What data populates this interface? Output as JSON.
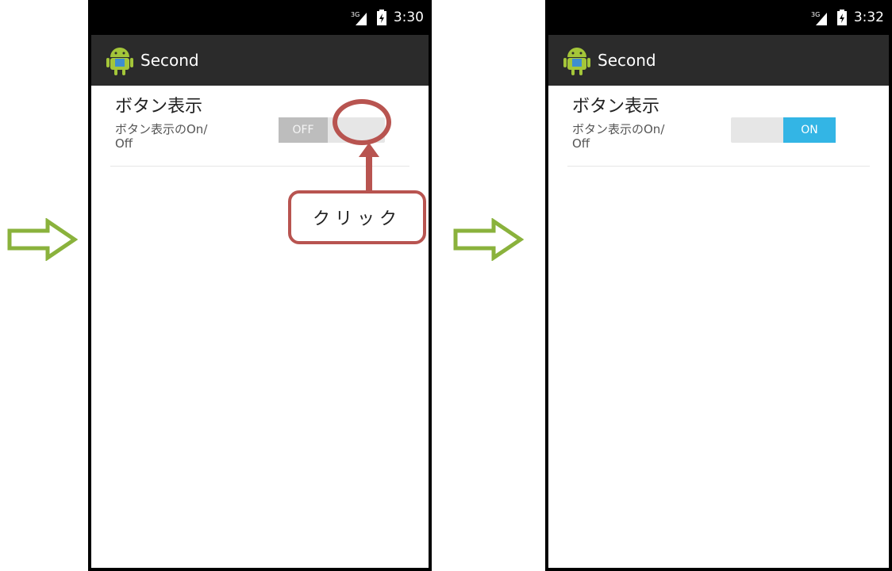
{
  "screens": [
    {
      "status_bar": {
        "network": "3G",
        "time": "3:30"
      },
      "action_bar": {
        "title": "Second"
      },
      "preference": {
        "title": "ボタン表示",
        "summary": "ボタン表示のOn/\nOff"
      },
      "switch": {
        "state": "off",
        "label": "OFF"
      }
    },
    {
      "status_bar": {
        "network": "3G",
        "time": "3:32"
      },
      "action_bar": {
        "title": "Second"
      },
      "preference": {
        "title": "ボタン表示",
        "summary": "ボタン表示のOn/\nOff"
      },
      "switch": {
        "state": "on",
        "label": "ON"
      }
    }
  ],
  "annotation": {
    "callout_text": "クリック",
    "color": "#b85450"
  },
  "colors": {
    "arrow": "#8ab23c",
    "switch_on": "#33b5e5",
    "switch_off": "#bdbdbd"
  },
  "icons": [
    "signal-3g-icon",
    "battery-icon",
    "android-app-icon",
    "right-arrow-icon"
  ]
}
